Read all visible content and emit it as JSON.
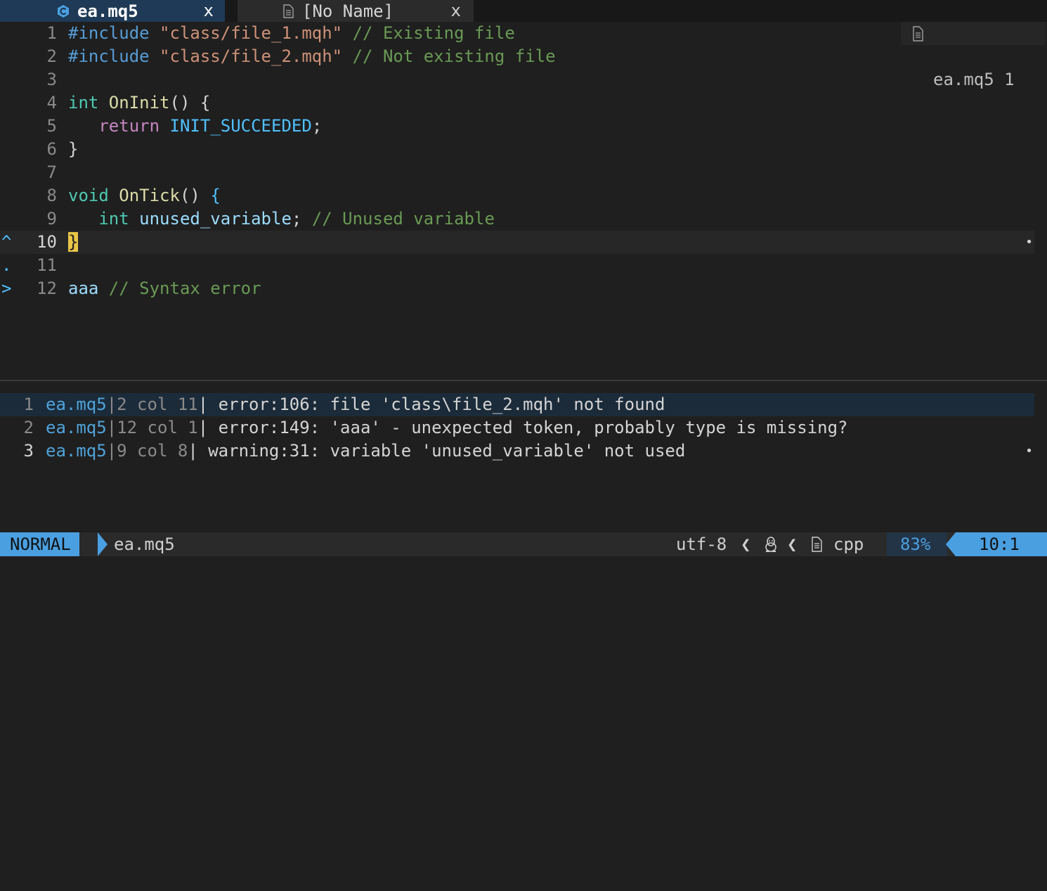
{
  "tabline": {
    "tabs": [
      {
        "label": "ea.mq5",
        "icon": "c-file-icon",
        "close": "x",
        "active": true
      },
      {
        "label": "[No Name]",
        "icon": "document-icon",
        "close": "x",
        "active": false
      }
    ]
  },
  "editor": {
    "float_info": {
      "icon": "document-icon",
      "text": "ea.mq5 1"
    },
    "lines": [
      {
        "num": "1",
        "sign": "",
        "tokens": [
          [
            "pp",
            "#include "
          ],
          [
            "str",
            "\"class/file_1.mqh\""
          ],
          [
            "cmt",
            " // Existing file"
          ]
        ]
      },
      {
        "num": "2",
        "sign": "",
        "tokens": [
          [
            "pp",
            "#include "
          ],
          [
            "str",
            "\"class/file_2.mqh\""
          ],
          [
            "cmt",
            " // Not existing file"
          ]
        ]
      },
      {
        "num": "3",
        "sign": "",
        "tokens": []
      },
      {
        "num": "4",
        "sign": "",
        "tokens": [
          [
            "kw",
            "int "
          ],
          [
            "fn",
            "OnInit"
          ],
          [
            "punc",
            "() {"
          ]
        ]
      },
      {
        "num": "5",
        "sign": "",
        "tokens": [
          [
            "punc",
            "   "
          ],
          [
            "ctl",
            "return "
          ],
          [
            "cst",
            "INIT_SUCCEEDED"
          ],
          [
            "punc",
            ";"
          ]
        ]
      },
      {
        "num": "6",
        "sign": "",
        "tokens": [
          [
            "punc",
            "}"
          ]
        ]
      },
      {
        "num": "7",
        "sign": "",
        "tokens": []
      },
      {
        "num": "8",
        "sign": "",
        "tokens": [
          [
            "kw",
            "void "
          ],
          [
            "fn",
            "OnTick"
          ],
          [
            "punc",
            "() "
          ],
          [
            "brace-blue",
            "{"
          ]
        ]
      },
      {
        "num": "9",
        "sign": "",
        "tokens": [
          [
            "punc",
            "   "
          ],
          [
            "kw",
            "int "
          ],
          [
            "var",
            "unused_variable"
          ],
          [
            "punc",
            "; "
          ],
          [
            "cmt",
            "// Unused variable"
          ]
        ]
      },
      {
        "num": "10",
        "sign": "^",
        "tokens": [
          [
            "brace-hl",
            "}"
          ]
        ],
        "current": true,
        "dot": "•"
      },
      {
        "num": "11",
        "sign": ".",
        "tokens": []
      },
      {
        "num": "12",
        "sign": ">",
        "tokens": [
          [
            "var",
            "aaa "
          ],
          [
            "cmt",
            "// Syntax error"
          ]
        ]
      }
    ]
  },
  "quickfix": {
    "items": [
      {
        "num": "1",
        "file": "ea.mq5",
        "loc": "2 col 11",
        "msg": " error:106: file 'class\\file_2.mqh' not found",
        "selected": true
      },
      {
        "num": "2",
        "file": "ea.mq5",
        "loc": "12 col 1",
        "msg": " error:149: 'aaa' - unexpected token, probably type is missing?"
      },
      {
        "num": "3",
        "file": "ea.mq5",
        "loc": "9 col 8",
        "msg": " warning:31: variable 'unused_variable' not used",
        "current": true,
        "dot": "•"
      }
    ]
  },
  "statusline": {
    "mode": "NORMAL",
    "filename": "ea.mq5",
    "encoding": "utf-8",
    "separator": "❮",
    "os_icon": "linux-penguin-icon",
    "filetype_icon": "document-icon",
    "filetype": "cpp",
    "percent": "83%",
    "position": "10:1"
  },
  "colors": {
    "background": "#1f1f1f",
    "accent": "#4a9fe0",
    "active_tab": "#1f3a56",
    "cursor_highlight": "#e8c547"
  }
}
